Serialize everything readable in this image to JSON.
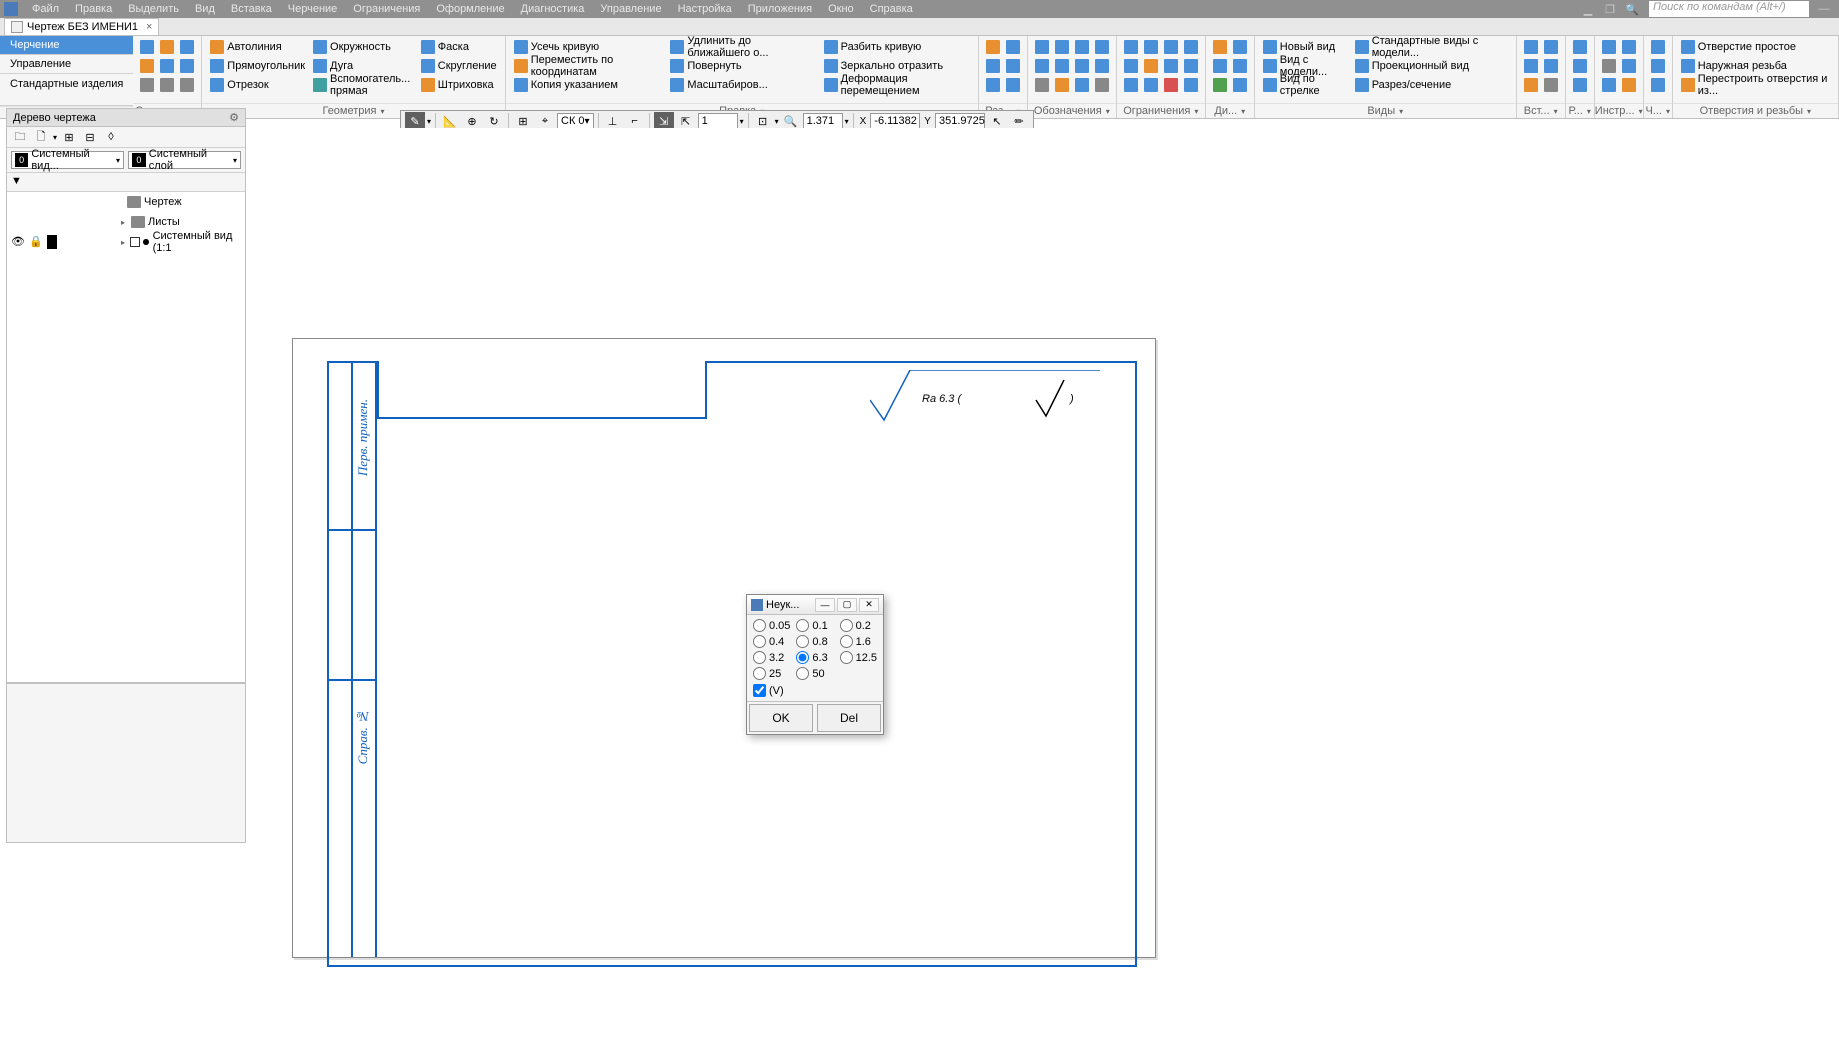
{
  "menu": {
    "items": [
      "Файл",
      "Правка",
      "Выделить",
      "Вид",
      "Вставка",
      "Черчение",
      "Ограничения",
      "Оформление",
      "Диагностика",
      "Управление",
      "Настройка",
      "Приложения",
      "Окно",
      "Справка"
    ],
    "search_placeholder": "Поиск по командам (Alt+/)"
  },
  "doc_tab": {
    "title": "Чертеж БЕЗ ИМЕНИ1",
    "close": "×"
  },
  "ribbon": {
    "left_tabs": {
      "active": "Черчение",
      "t2": "Управление",
      "t3": "Стандартные изделия"
    },
    "groups": {
      "system": "Системная",
      "geometry": {
        "label": "Геометрия",
        "autoline": "Автолиния",
        "circle": "Окружность",
        "chamfer": "Фаска",
        "rect": "Прямоугольник",
        "arc": "Дуга",
        "fillet": "Скругление",
        "segment": "Отрезок",
        "aux": "Вспомогатель... прямая",
        "hatch": "Штриховка"
      },
      "edit": {
        "label": "Правка",
        "trim": "Усечь кривую",
        "extend": "Удлинить до ближайшего о...",
        "split": "Разбить кривую",
        "move": "Переместить по координатам",
        "rotate": "Повернуть",
        "mirror": "Зеркально отразить",
        "copy": "Копия указанием",
        "scale": "Масштабиров...",
        "deform": "Деформация перемещением"
      },
      "dim": "Раз...",
      "annot": "Обозначения",
      "constr": "Ограничения",
      "diag": "Ди...",
      "views": {
        "label": "Виды",
        "new_view": "Новый вид",
        "std_views": "Стандартные виды с модели...",
        "model_view": "Вид с модели...",
        "proj_view": "Проекционный вид",
        "arrow_view": "Вид по стрелке",
        "section": "Разрез/сечение"
      },
      "insert": "Вст...",
      "r": "Р...",
      "tools": "Инстр...",
      "cad": "Ч...",
      "holes": {
        "label": "Отверстия и резьбы",
        "simple": "Отверстие простое",
        "thread": "Наружная резьба",
        "rebuild": "Перестроить отверстия и из..."
      }
    }
  },
  "toolbar": {
    "cs": "СК 0",
    "scale_factor": "1",
    "zoom": "1.371",
    "x_label": "X",
    "x": "-6.11382",
    "y_label": "Y",
    "y": "351.9725"
  },
  "tree": {
    "title": "Дерево чертежа",
    "combo1": "Системный вид...",
    "combo2": "Системный слой",
    "badge": "0",
    "root": "Чертеж",
    "sheets": "Листы",
    "sysview": "Системный вид (1:1"
  },
  "drawing": {
    "side1": "Перв. примен.",
    "side2": "Справ. №",
    "surface": "Ra 6.3 ( √ )"
  },
  "dialog": {
    "title": "Неук...",
    "opts": [
      "0.05",
      "0.1",
      "0.2",
      "0.4",
      "0.8",
      "1.6",
      "3.2",
      "6.3",
      "12.5",
      "25",
      "50"
    ],
    "selected": "6.3",
    "checkbox": "(V)",
    "ok": "OK",
    "del": "Del"
  }
}
